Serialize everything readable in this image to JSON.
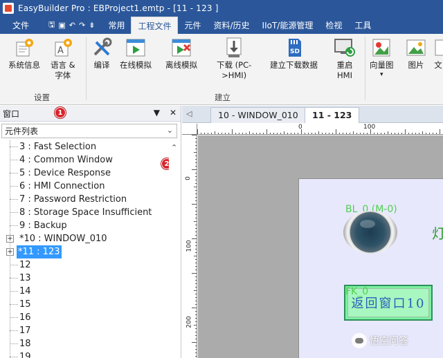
{
  "window": {
    "title": "EasyBuilder Pro : EBProject1.emtp - [11 - 123 ]"
  },
  "ribbon_tabs": {
    "file": "文件",
    "common": "常用",
    "project_file": "工程文件",
    "parts": "元件",
    "data_history": "资料/历史",
    "iiot": "IIoT/能源管理",
    "inspect": "检视",
    "tools": "工具"
  },
  "ribbon": {
    "sysinfo": "系统信息",
    "lang_line1": "语言 &",
    "lang_line2": "字体",
    "group_settings": "设置",
    "compile": "编译",
    "online_sim": "在线模拟",
    "offline_sim": "离线模拟",
    "download_line1": "下载 (PC-",
    "download_line2": ">HMI)",
    "build_download": "建立下载数据",
    "restart_line1": "重启",
    "restart_line2": "HMI",
    "group_build": "建立",
    "wizard": "向量图",
    "picture": "图片",
    "text_cut": "文"
  },
  "panel": {
    "title": "窗口",
    "marker1": "1",
    "marker2": "2",
    "combo_value": "元件列表",
    "items": [
      "3 : Fast Selection",
      "4 : Common Window",
      "5 : Device Response",
      "6 : HMI Connection",
      "7 : Password Restriction",
      "8 : Storage Space Insufficient",
      "9 : Backup",
      "*10 : WINDOW_010",
      "*11 : 123",
      "12",
      "13",
      "14",
      "15",
      "16",
      "17",
      "18",
      "19"
    ]
  },
  "doc_tabs": {
    "tab1": "10 - WINDOW_010",
    "tab2": "11 - 123"
  },
  "ruler": {
    "top_0": "0",
    "top_100": "100",
    "left_0": "0",
    "left_100": "100",
    "left_200": "200"
  },
  "canvas": {
    "bl_label": "BL_0 (M-0)",
    "fk_label": "FK_0",
    "fk_text": "返回窗口10",
    "cut_char": "灯"
  },
  "watermark": {
    "text": "悟空问答"
  },
  "colors": {
    "title_blue": "#2b579a",
    "ribbon_bg": "#f3f3f3",
    "selection": "#3399ff",
    "marker_red": "#d9242b",
    "canvas_gray": "#ababab",
    "screen_bg": "#e8e8fc",
    "label_green": "#4fd04f",
    "button_green": "#7cf0a0",
    "button_text": "#2a5fb7"
  }
}
